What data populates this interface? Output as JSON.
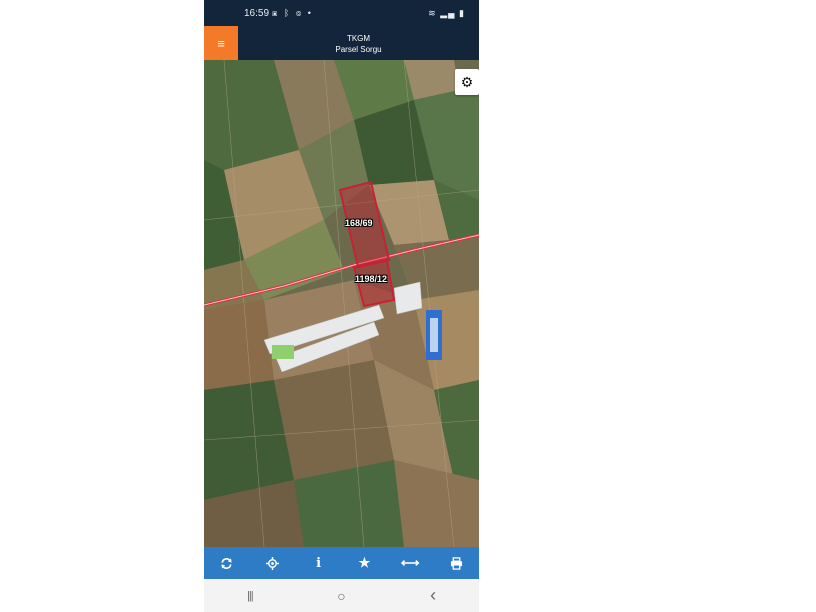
{
  "status_bar": {
    "time": "16:59",
    "left_icons": [
      "image-icon",
      "bluetooth-icon",
      "instagram-icon",
      "dot-icon"
    ],
    "right_icons": [
      "wifi-icon",
      "signal-icon",
      "battery-icon"
    ]
  },
  "header": {
    "title_line1": "TKGM",
    "title_line2": "Parsel Sorgu",
    "menu_icon": "hamburger-icon",
    "bg_color": "#12253a",
    "menu_color": "#f47a2a"
  },
  "map": {
    "settings_icon": "gear-icon",
    "parcels": [
      {
        "label": "168/69"
      },
      {
        "label": "1198/12"
      }
    ],
    "parcel_outline_color": "#c62235",
    "road_color": "#d8333f"
  },
  "toolbar": {
    "bg_color": "#2e7bc6",
    "buttons": [
      {
        "icon": "refresh-icon"
      },
      {
        "icon": "locate-icon"
      },
      {
        "icon": "info-icon",
        "glyph": "i"
      },
      {
        "icon": "star-icon",
        "glyph": "★"
      },
      {
        "icon": "measure-icon",
        "glyph": "⟷"
      },
      {
        "icon": "print-icon"
      }
    ]
  },
  "nav_bar": {
    "buttons": [
      {
        "icon": "recent-apps-icon",
        "glyph": "|||"
      },
      {
        "icon": "home-icon",
        "glyph": "○"
      },
      {
        "icon": "back-icon",
        "glyph": "‹"
      }
    ]
  }
}
